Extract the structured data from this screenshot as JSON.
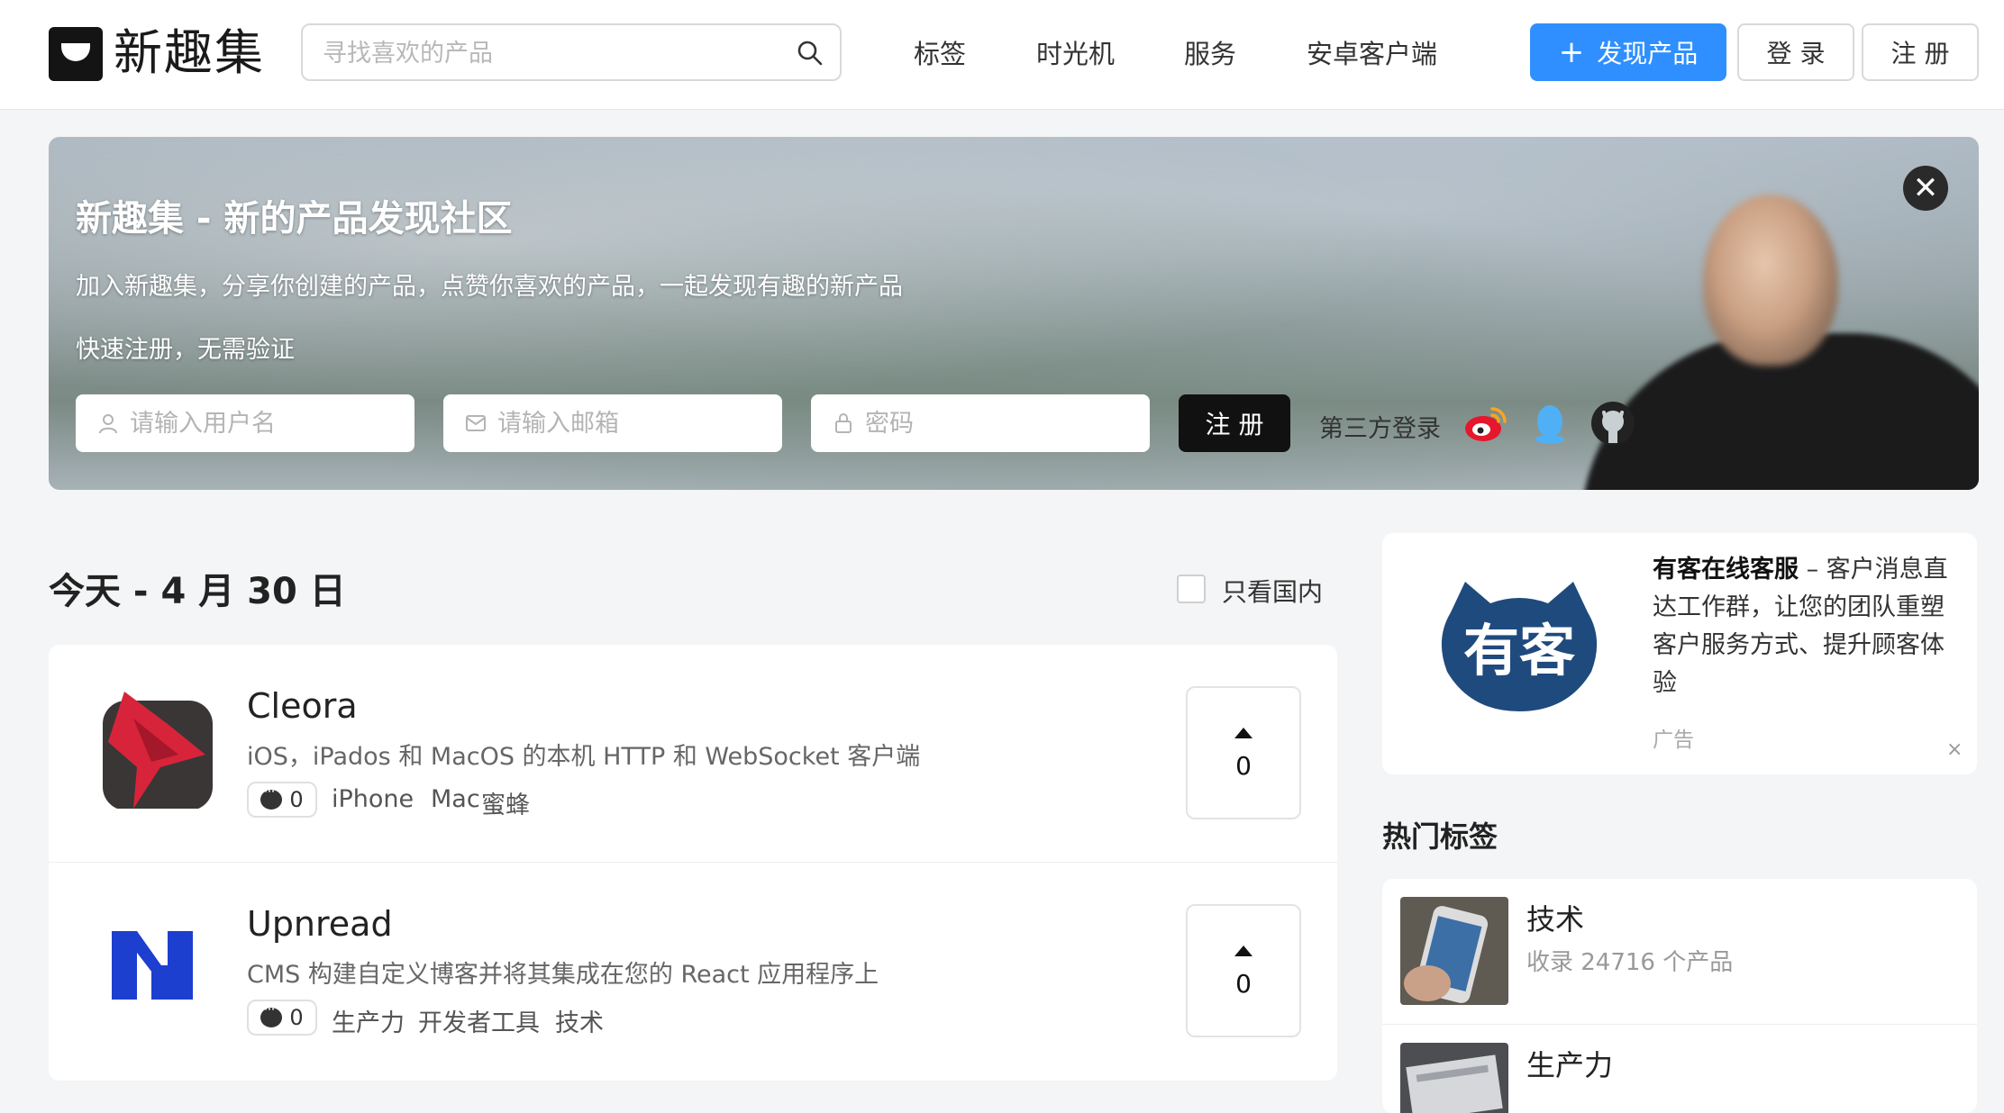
{
  "header": {
    "logo_text": "新趣集",
    "search_placeholder": "寻找喜欢的产品",
    "nav": [
      "标签",
      "时光机",
      "服务",
      "安卓客户端"
    ],
    "discover_label": "发现产品",
    "login_label": "登 录",
    "signup_label": "注 册",
    "accent": "#2f8fff"
  },
  "banner": {
    "title": "新趣集 - 新的产品发现社区",
    "subtitle": "加入新趣集，分享你创建的产品，点赞你喜欢的产品，一起发现有趣的新产品",
    "quick": "快速注册，无需验证",
    "username_placeholder": "请输入用户名",
    "email_placeholder": "请输入邮箱",
    "password_placeholder": "密码",
    "register_label": "注 册",
    "third_party_label": "第三方登录",
    "close_label": "✕"
  },
  "main": {
    "day_title": "今天 - 4 月 30 日",
    "filter_label": "只看国内",
    "items": [
      {
        "name": "Cleora",
        "desc": "iOS，iPados 和 MacOS 的本机 HTTP 和 WebSocket 客户端",
        "comments": "0",
        "tags": [
          "iPhone",
          "Mac",
          "蜜蜂"
        ],
        "votes": "0"
      },
      {
        "name": "Upnread",
        "desc": "CMS 构建自定义博客并将其集成在您的 React 应用程序上",
        "comments": "0",
        "tags": [
          "生产力",
          "开发者工具",
          "技术"
        ],
        "votes": "0"
      }
    ]
  },
  "sidebar": {
    "ad": {
      "logo_text": "有客",
      "title": "有客在线客服",
      "body": " – 客户消息直达工作群，让您的团队重塑客户服务方式、提升顾客体验",
      "label": "广告",
      "close": "×"
    },
    "hot_tags_title": "热门标签",
    "tags": [
      {
        "name": "技术",
        "count": "收录 24716 个产品"
      },
      {
        "name": "生产力",
        "count": ""
      }
    ]
  }
}
